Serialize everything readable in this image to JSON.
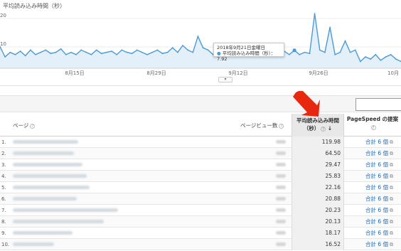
{
  "chart": {
    "metric_label": "平均読み込み時間（秒）",
    "y_labels": [
      "20",
      "10"
    ],
    "x_labels": [
      "8月15日",
      "8月29日",
      "9月12日",
      "9月26日",
      "10月"
    ],
    "tooltip": {
      "date": "2018年9月21日金曜日",
      "series": "平均読み込み時間（秒）",
      "value": "7.92"
    },
    "colors": {
      "line": "#4b9ad6",
      "fill": "#e3eff9"
    }
  },
  "chart_data": {
    "type": "area",
    "title": "",
    "xlabel": "",
    "ylabel": "平均読み込み時間（秒）",
    "ylim": [
      0,
      25
    ],
    "x": [
      1,
      2,
      3,
      4,
      5,
      6,
      7,
      8,
      9,
      10,
      11,
      12,
      13,
      14,
      15,
      16,
      17,
      18,
      19,
      20,
      21,
      22,
      23,
      24,
      25,
      26,
      27,
      28,
      29,
      30,
      31,
      32,
      33,
      34,
      35,
      36,
      37,
      38,
      39,
      40,
      41,
      42,
      43,
      44,
      45,
      46,
      47,
      48,
      49,
      50,
      51,
      52,
      53,
      54,
      55,
      56,
      57,
      58,
      59,
      60,
      61,
      62,
      63,
      64,
      65,
      66,
      67,
      68,
      69,
      70,
      71,
      72,
      73,
      74,
      75,
      76,
      77,
      78,
      79,
      80
    ],
    "series": [
      {
        "name": "平均読み込み時間（秒）",
        "values": [
          9.5,
          5,
          7,
          6,
          7.5,
          5.5,
          8,
          6,
          7,
          8,
          6.5,
          7,
          8.5,
          6,
          7,
          6,
          8,
          7,
          6,
          8,
          6.5,
          7,
          7.5,
          6,
          8,
          7,
          6.5,
          8,
          7,
          6,
          7,
          8,
          6.5,
          7,
          9,
          7,
          10,
          8,
          7,
          14,
          9,
          8,
          6,
          7,
          8.5,
          7,
          6.5,
          8,
          7,
          6,
          7,
          7.5,
          6,
          7.2,
          6.5,
          7,
          7.5,
          6,
          7.92,
          6,
          7,
          6.5,
          24,
          8,
          7,
          18,
          6,
          7,
          12,
          7,
          8,
          3,
          5,
          4,
          6,
          3.5,
          5,
          6,
          4,
          3
        ]
      }
    ]
  },
  "table": {
    "columns": {
      "page": "ページ",
      "views": "ページビュー数",
      "avg_load_line1": "平均読み込み時間",
      "avg_load_line2": "（秒）",
      "pagespeed": "PageSpeed の提案"
    },
    "rows": [
      {
        "index": "1.",
        "value": "119.98",
        "suggestion": "合計 6 個"
      },
      {
        "index": "2.",
        "value": "64.50",
        "suggestion": "合計 6 個"
      },
      {
        "index": "3.",
        "value": "29.47",
        "suggestion": "合計 6 個"
      },
      {
        "index": "4.",
        "value": "25.83",
        "suggestion": "合計 6 個"
      },
      {
        "index": "5.",
        "value": "22.16",
        "suggestion": "合計 6 個"
      },
      {
        "index": "6.",
        "value": "20.88",
        "suggestion": "合計 6 個"
      },
      {
        "index": "7.",
        "value": "20.23",
        "suggestion": "合計 6 個"
      },
      {
        "index": "8.",
        "value": "20.13",
        "suggestion": "合計 6 個"
      },
      {
        "index": "9.",
        "value": "18.17",
        "suggestion": "合計 6 個"
      },
      {
        "index": "10.",
        "value": "16.52",
        "suggestion": "合計 6 個"
      }
    ]
  }
}
